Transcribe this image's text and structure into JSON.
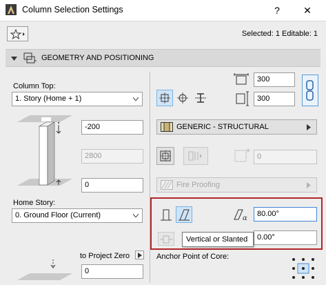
{
  "window": {
    "title": "Column Selection Settings",
    "help": "?",
    "close": "✕"
  },
  "header": {
    "selection_info": "Selected: 1 Editable: 1"
  },
  "section": {
    "title": "GEOMETRY AND POSITIONING"
  },
  "left": {
    "column_top_label": "Column Top:",
    "column_top_value": "1. Story (Home + 1)",
    "top_offset": "-200",
    "height": "2800",
    "bottom_offset": "0",
    "home_story_label": "Home Story:",
    "home_story_value": "0. Ground Floor (Current)",
    "to_project_zero_label": "to Project Zero",
    "project_zero_value": "0"
  },
  "right": {
    "width": "300",
    "depth": "300",
    "material_label": "GENERIC - STRUCTURAL",
    "veneer_thickness": "0",
    "fire_proofing_label": "Fire Proofing",
    "slant_angle": "80.00°",
    "slant_direction": "0.00°",
    "tooltip": "Vertical or Slanted",
    "anchor_label": "Anchor Point of Core:"
  },
  "colors": {
    "highlight_box": "#b1262b",
    "selected_button": "#cfe4f7"
  }
}
